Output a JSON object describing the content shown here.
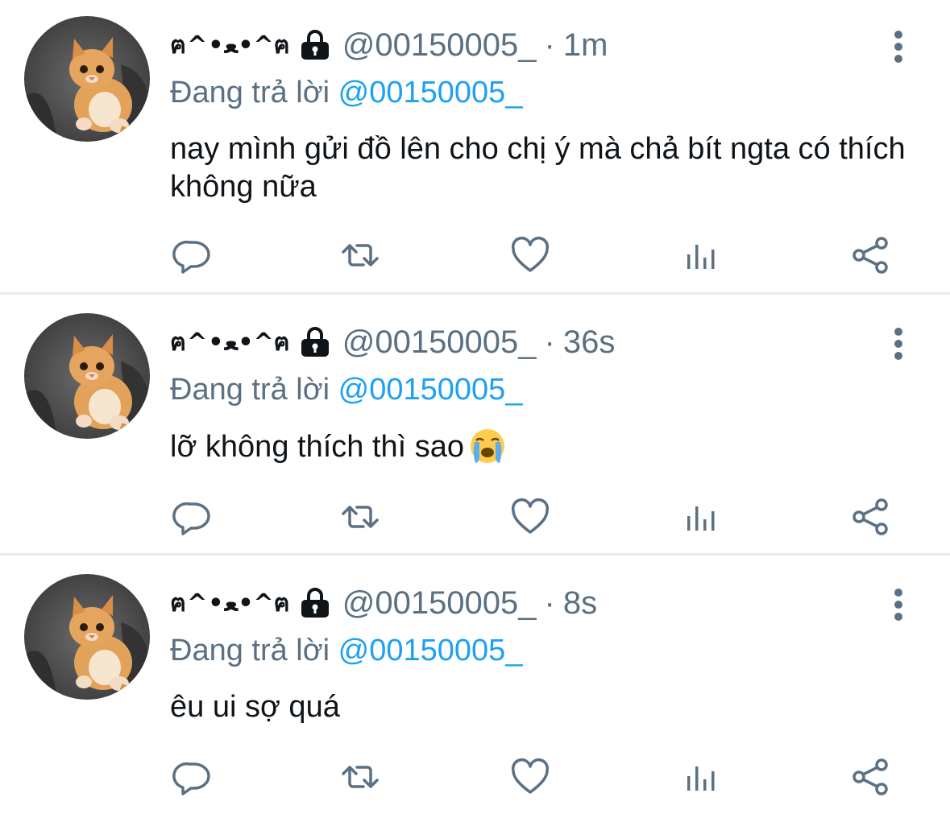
{
  "colors": {
    "secondary_text": "#5b7083",
    "mention_blue": "#1da1f2",
    "primary_text": "#0f1419",
    "divider": "#e6ecf0"
  },
  "icons": {
    "lock": "lock-icon",
    "more": "more-vertical-icon",
    "reply": "reply-icon",
    "retweet": "retweet-icon",
    "like": "heart-icon",
    "analytics": "analytics-icon",
    "share": "share-icon"
  },
  "tweets": [
    {
      "display_name": "ฅ^•ﻌ•^ฅ",
      "handle": "@00150005_",
      "separator": "·",
      "time": "1m",
      "reply_prefix": "Đang trả lời",
      "reply_to": "@00150005_",
      "text": "nay mình gửi đồ lên cho chị ý mà chả bít ngta có thích không nữa",
      "emoji": ""
    },
    {
      "display_name": "ฅ^•ﻌ•^ฅ",
      "handle": "@00150005_",
      "separator": "·",
      "time": "36s",
      "reply_prefix": "Đang trả lời",
      "reply_to": "@00150005_",
      "text": "lỡ không thích thì sao",
      "emoji": "loudly-crying-face"
    },
    {
      "display_name": "ฅ^•ﻌ•^ฅ",
      "handle": "@00150005_",
      "separator": "·",
      "time": "8s",
      "reply_prefix": "Đang trả lời",
      "reply_to": "@00150005_",
      "text": "êu ui sợ quá",
      "emoji": ""
    }
  ]
}
